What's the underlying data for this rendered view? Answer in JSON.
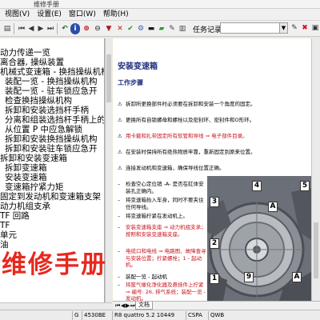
{
  "window": {
    "title": "维修手册"
  },
  "menu": [
    "视图(V)",
    "设置(E)",
    "窗口(W)",
    "帮助(H)"
  ],
  "task": {
    "label": "任务记录:",
    "value": ""
  },
  "tree": {
    "items": [
      "动力传递一览",
      "离合器, 操纵装置",
      "机械式变速箱 - 换挡操纵机构",
      "装配一览 - 换挡操纵机构",
      "装配一览 - 驻车锁应急开",
      "检查换挡操纵机构",
      "拆卸和安装选挡杆手柄",
      "分离和组装选挡杆手柄上的",
      "从位置 P 中应急解锁",
      "拆卸和安装换挡操纵机构",
      "拆卸和安装驻车锁应急开",
      "拆卸和安装变速箱",
      "拆卸变速箱",
      "安装变速箱",
      "变速箱拧紧力矩",
      "固定到发动机和变速箱支架",
      "动力机组支承",
      "TF 回路",
      "TF",
      "单元",
      "油",
      "",
      "",
      ""
    ]
  },
  "watermark": {
    "big": "维修手册",
    "faint": ""
  },
  "doc": {
    "title": "安装变速箱",
    "subtitle": "工作步骤",
    "steps": [
      {
        "mark": "⚠",
        "text": "拆卸所更换部件时必须要在拆卸和安装一个角度的固定。",
        "red": false
      },
      {
        "mark": "⚠",
        "text": "更换所有自锁螺母和螺栓以及密封环、密封件和O形环。",
        "red": false
      },
      {
        "mark": "⚠",
        "text": "用卡箍和扎带固定所有软管和导线 ⇒ 电子部件目录。",
        "red": true
      },
      {
        "mark": "⚠",
        "text": "在安装时保持所有绝热物质牢靠，重新固定到原来位置。",
        "red": false
      },
      {
        "mark": "⚠",
        "text": "连接发动机和变速箱，确保导线位置正确。",
        "red": false
      },
      {
        "mark": "–",
        "text": "检查空心定位销 -A- 是否在缸体安装孔正确内。",
        "red": false
      },
      {
        "mark": "–",
        "text": "将变速箱抬入车身，同时不要夹住任何导线。",
        "red": false
      },
      {
        "mark": "–",
        "text": "将变速箱拧紧在发动机上。",
        "red": false
      },
      {
        "mark": "–",
        "text": "安装变速箱支座 ⇒ 动力机组支承；按照和安装变速箱支座。",
        "red": false
      },
      {
        "mark": "–",
        "text": "电缆口和电线 ⇒ 电路图、故障查寻与安装位置；拧紧螺栓；1 - 起动机。",
        "red": false
      },
      {
        "mark": "–",
        "text": "装配一览 - 起动机",
        "red": false
      },
      {
        "mark": "–",
        "text": "将废气催化净化器及悬挂件上拧紧 ⇒ 编号: 26, 排气系统；装配一览 - 发动机。",
        "red": false
      }
    ],
    "callouts": [
      "4",
      "3",
      "5",
      "A",
      "2",
      "1",
      "9",
      "A"
    ]
  },
  "tabbar": {
    "tab_label": "文档"
  },
  "status": {
    "cells": [
      "G",
      "4530BE",
      "R8 quattro 5.2 10449",
      "CSPA",
      "QWB"
    ]
  },
  "colors": {
    "title_blue": "#1f2d7a",
    "warning_red": "#c8141e",
    "watermark_red": "#e8281e"
  }
}
